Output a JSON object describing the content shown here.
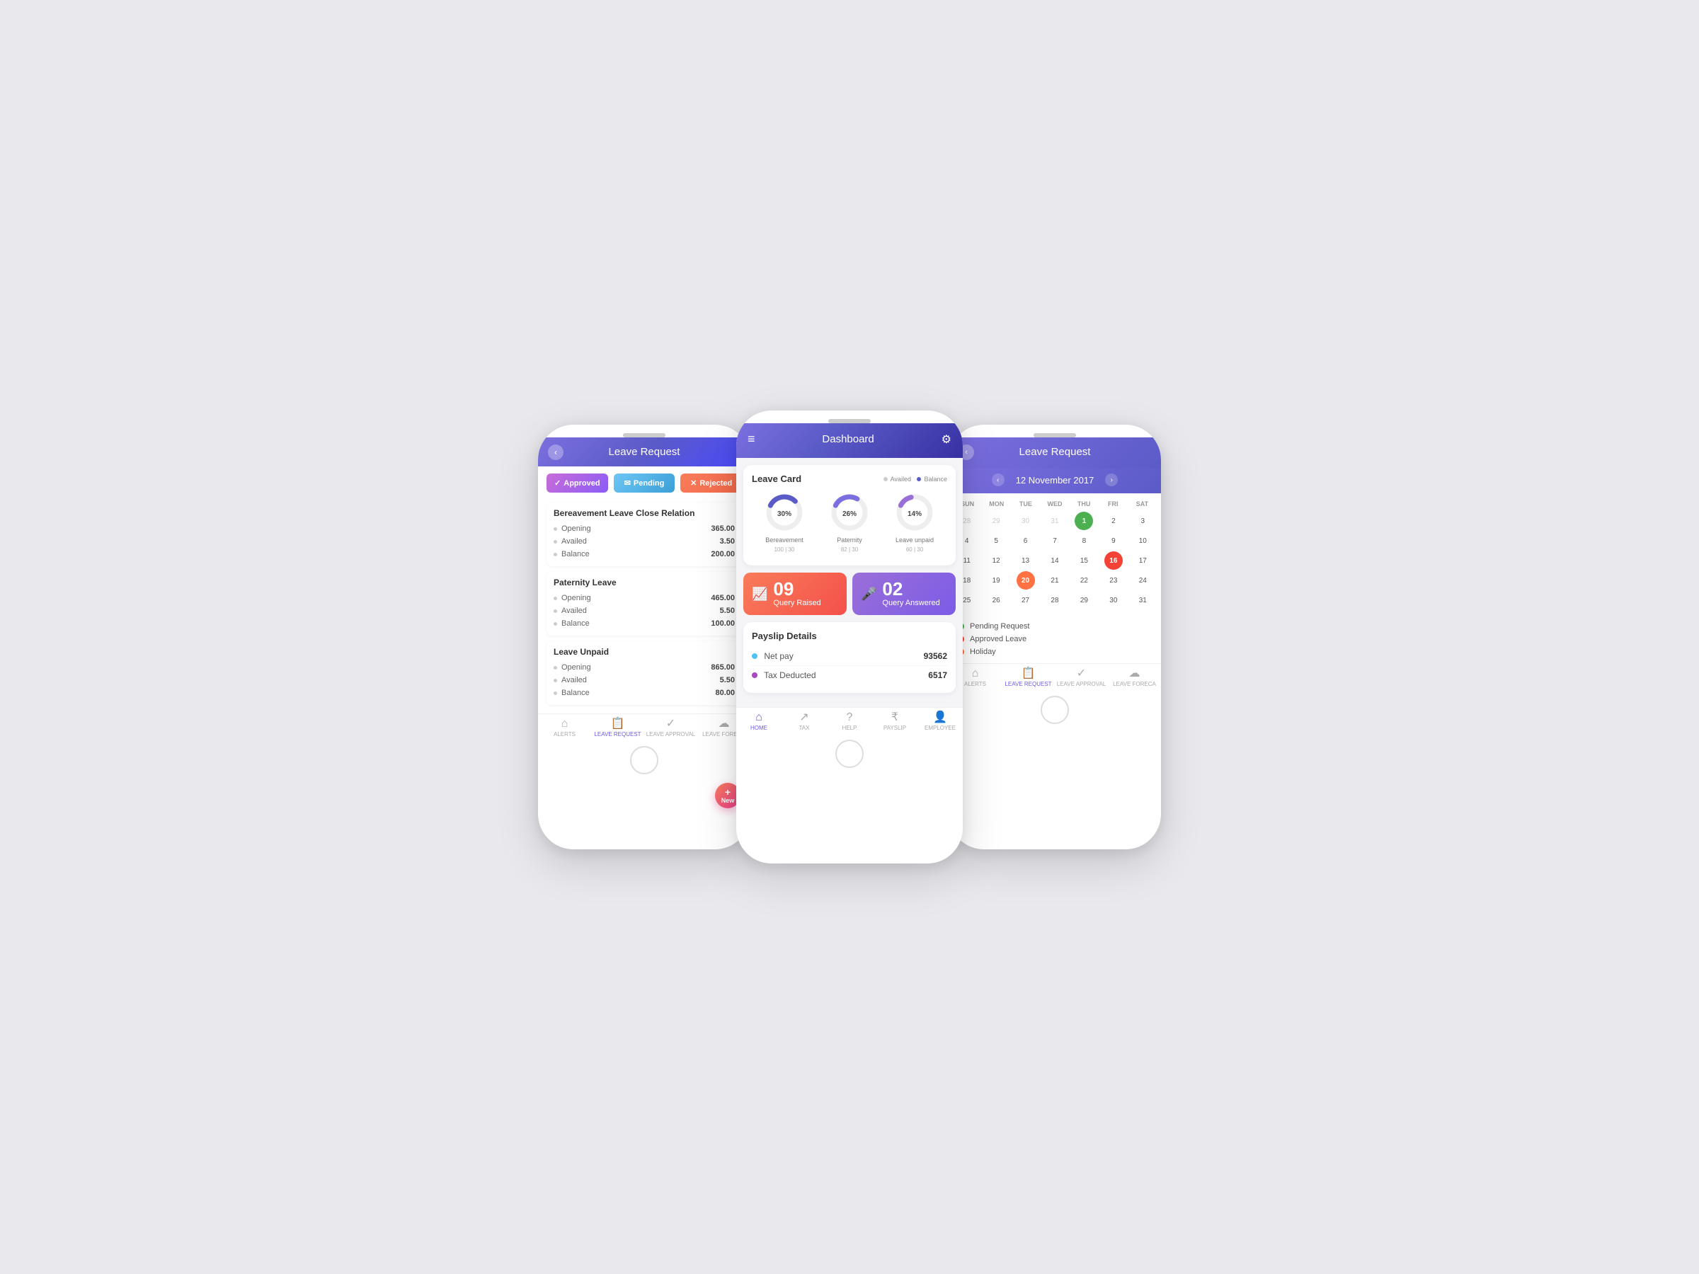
{
  "leftPhone": {
    "header": "Leave Request",
    "tabs": [
      {
        "label": "Approved",
        "icon": "✓",
        "class": "tab-approved"
      },
      {
        "label": "Pending",
        "icon": "✉",
        "class": "tab-pending"
      },
      {
        "label": "Rejected",
        "icon": "✕",
        "class": "tab-rejected"
      }
    ],
    "leaveSections": [
      {
        "title": "Bereavement Leave Close Relation",
        "rows": [
          {
            "label": "Opening",
            "value": "365.00"
          },
          {
            "label": "Availed",
            "value": "3.50"
          },
          {
            "label": "Balance",
            "value": "200.00"
          }
        ]
      },
      {
        "title": "Paternity Leave",
        "rows": [
          {
            "label": "Opening",
            "value": "465.00"
          },
          {
            "label": "Availed",
            "value": "5.50"
          },
          {
            "label": "Balance",
            "value": "100.00"
          }
        ]
      },
      {
        "title": "Leave Unpaid",
        "rows": [
          {
            "label": "Opening",
            "value": "865.00"
          },
          {
            "label": "Availed",
            "value": "5.50"
          },
          {
            "label": "Balance",
            "value": "80.00"
          }
        ]
      }
    ],
    "fab": {
      "icon": "+",
      "label": "New"
    },
    "navItems": [
      {
        "label": "ALERTS",
        "icon": "⌂",
        "active": false
      },
      {
        "label": "LEAVE REQUEST",
        "icon": "📋",
        "active": true
      },
      {
        "label": "LEAVE APPROVAL",
        "icon": "✓",
        "active": false
      },
      {
        "label": "LEAVE FORECA",
        "icon": "☁",
        "active": false
      }
    ]
  },
  "centerPhone": {
    "header": "Dashboard",
    "leaveCard": {
      "title": "Leave Card",
      "legend": [
        {
          "label": "Availed",
          "color": "#ccc"
        },
        {
          "label": "Balance",
          "color": "#5b5bc8"
        }
      ],
      "donuts": [
        {
          "label": "Bereavement",
          "sub": "100 | 30",
          "pct": 30,
          "color": "#5b5bc8"
        },
        {
          "label": "Paternity",
          "sub": "82 | 30",
          "pct": 26,
          "color": "#7c6fe0"
        },
        {
          "label": "Leave unpaid",
          "sub": "60 | 30",
          "pct": 14,
          "color": "#9b6fd8"
        }
      ]
    },
    "queryCards": [
      {
        "num": "09",
        "label": "Query Raised",
        "icon": "📈",
        "class": "query-card-raised"
      },
      {
        "num": "02",
        "label": "Query Answered",
        "icon": "🎤",
        "class": "query-card-answered"
      }
    ],
    "payslip": {
      "title": "Payslip Details",
      "rows": [
        {
          "label": "Net pay",
          "dotClass": "dot-blue",
          "value": "93562"
        },
        {
          "label": "Tax Deducted",
          "dotClass": "dot-purple",
          "value": "6517"
        }
      ]
    },
    "navItems": [
      {
        "label": "HOME",
        "icon": "⌂",
        "active": true
      },
      {
        "label": "TAX",
        "icon": "↗",
        "active": false
      },
      {
        "label": "HELP",
        "icon": "?",
        "active": false
      },
      {
        "label": "PAYSLIP",
        "icon": "₹",
        "active": false
      },
      {
        "label": "EMPLOYEE",
        "icon": "👤",
        "active": false
      }
    ]
  },
  "rightPhone": {
    "header": "Leave Request",
    "calNav": {
      "month": "12  November  2017",
      "prevIcon": "<",
      "nextIcon": ">"
    },
    "dayLabels": [
      "SUN",
      "MON",
      "TUE",
      "WED",
      "THU",
      "FRI",
      "SAT"
    ],
    "calWeeks": [
      [
        {
          "day": "28",
          "class": "other-month"
        },
        {
          "day": "29",
          "class": "other-month"
        },
        {
          "day": "30",
          "class": "other-month"
        },
        {
          "day": "31",
          "class": "other-month"
        },
        {
          "day": "1",
          "class": "today-green"
        },
        {
          "day": "2",
          "class": ""
        },
        {
          "day": "3",
          "class": ""
        }
      ],
      [
        {
          "day": "4",
          "class": ""
        },
        {
          "day": "5",
          "class": ""
        },
        {
          "day": "6",
          "class": ""
        },
        {
          "day": "7",
          "class": ""
        },
        {
          "day": "8",
          "class": ""
        },
        {
          "day": "9",
          "class": ""
        },
        {
          "day": "10",
          "class": ""
        }
      ],
      [
        {
          "day": "11",
          "class": ""
        },
        {
          "day": "12",
          "class": ""
        },
        {
          "day": "13",
          "class": ""
        },
        {
          "day": "14",
          "class": ""
        },
        {
          "day": "15",
          "class": ""
        },
        {
          "day": "16",
          "class": "highlight-red"
        },
        {
          "day": "17",
          "class": ""
        }
      ],
      [
        {
          "day": "18",
          "class": ""
        },
        {
          "day": "19",
          "class": ""
        },
        {
          "day": "20",
          "class": "highlight-orange"
        },
        {
          "day": "21",
          "class": ""
        },
        {
          "day": "22",
          "class": ""
        },
        {
          "day": "23",
          "class": ""
        },
        {
          "day": "24",
          "class": ""
        }
      ],
      [
        {
          "day": "25",
          "class": ""
        },
        {
          "day": "26",
          "class": ""
        },
        {
          "day": "27",
          "class": ""
        },
        {
          "day": "28",
          "class": ""
        },
        {
          "day": "29",
          "class": ""
        },
        {
          "day": "30",
          "class": ""
        },
        {
          "day": "31",
          "class": ""
        }
      ]
    ],
    "legend": [
      {
        "label": "Pending Request",
        "colorClass": "lc-green"
      },
      {
        "label": "Approved Leave",
        "colorClass": "lc-red"
      },
      {
        "label": "Holiday",
        "colorClass": "lc-orange"
      }
    ],
    "navItems": [
      {
        "label": "ALERTS",
        "icon": "⌂",
        "active": false
      },
      {
        "label": "LEAVE REQUEST",
        "icon": "📋",
        "active": true
      },
      {
        "label": "LEAVE APPROVAL",
        "icon": "✓",
        "active": false
      },
      {
        "label": "LEAVE FORECA",
        "icon": "☁",
        "active": false
      }
    ]
  }
}
